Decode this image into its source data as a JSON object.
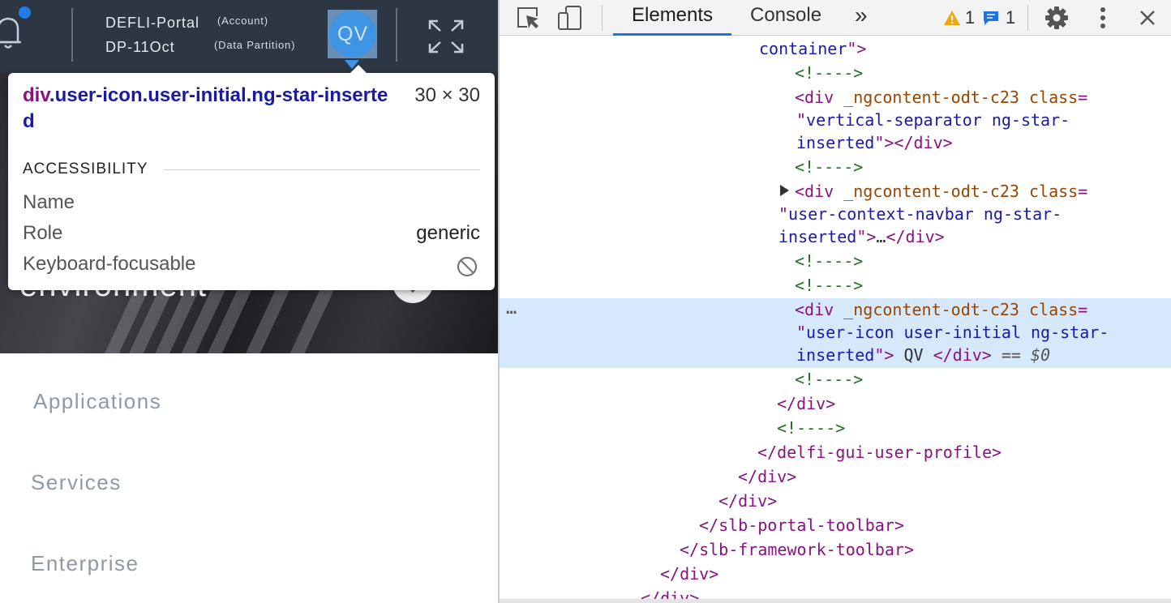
{
  "app": {
    "header": {
      "portal_name": "DEFLI-Portal",
      "account_label": "(Account)",
      "partition_name": "DP-11Oct",
      "partition_label": "(Data Partition)",
      "user_initials": "QV"
    },
    "hero": {
      "title": "environment"
    },
    "nav": {
      "items": [
        "Applications",
        "Services",
        "Enterprise"
      ]
    }
  },
  "tooltip": {
    "tag": "div",
    "classes": ".user-icon.user-initial.ng-star-inserted",
    "size": "30 × 30",
    "section_title": "ACCESSIBILITY",
    "rows": [
      {
        "label": "Name",
        "value": ""
      },
      {
        "label": "Role",
        "value": "generic"
      },
      {
        "label": "Keyboard-focusable",
        "value": "not-focusable"
      }
    ]
  },
  "devtools": {
    "tabs": [
      "Elements",
      "Console"
    ],
    "active_tab": "Elements",
    "more_tabs_label": "»",
    "warnings_count": "1",
    "messages_count": "1",
    "icons": [
      "inspect-element-icon",
      "device-toolbar-icon",
      "warning-icon",
      "message-icon",
      "settings-icon",
      "more-options-icon",
      "close-icon"
    ],
    "selected_line_suffix": "== $0",
    "selected_indicator": "…",
    "dom": {
      "container_val": "container",
      "empty_comment": "<!---->",
      "vsep_attr": "_ngcontent-odt-c23 class",
      "vsep_val1": "vertical-separator ng-star-",
      "vsep_val2": "inserted",
      "ucn_attr": "_ngcontent-odt-c23 class",
      "ucn_val1": "user-context-navbar ng-star-",
      "ucn_val2": "inserted",
      "ucn_collapsed": "…",
      "ui_attr": "_ngcontent-odt-c23 class",
      "ui_val1": "user-icon user-initial ng-star-",
      "ui_val2": "inserted",
      "ui_text": " QV ",
      "close_div": "</div>",
      "close_profile": "</delfi-gui-user-profile>",
      "close_portal_toolbar": "</slb-portal-toolbar>",
      "close_framework_toolbar": "</slb-framework-toolbar>"
    }
  },
  "colors": {
    "header_bg": "#2d3643",
    "user_avatar": "#3f95e4",
    "devtools_selection": "#d6e8fb",
    "tab_accent": "#1a73e8",
    "warning": "#f2a60c",
    "message": "#1a73e8"
  }
}
